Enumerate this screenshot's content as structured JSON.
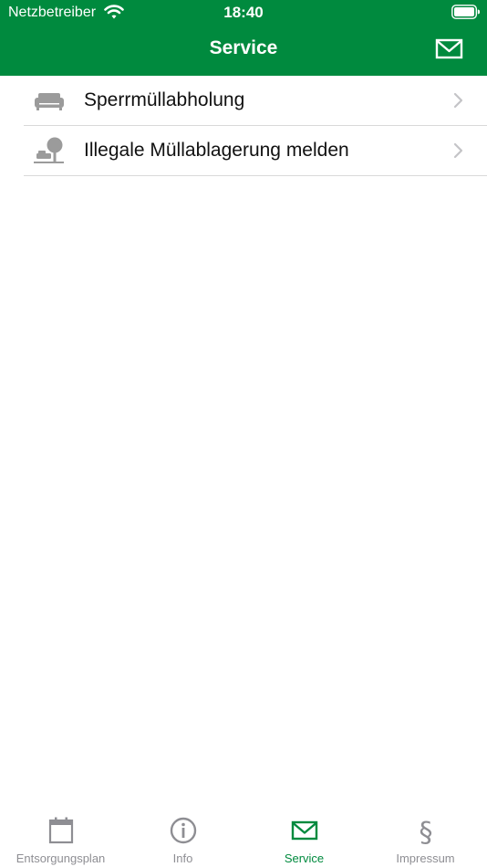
{
  "status_bar": {
    "carrier": "Netzbetreiber",
    "time": "18:40",
    "icons": [
      "wifi-icon",
      "battery-icon"
    ]
  },
  "nav": {
    "title": "Service",
    "right_button_icon": "mail-icon"
  },
  "services": [
    {
      "label": "Sperrmüllabholung",
      "icon": "sofa-icon"
    },
    {
      "label": "Illegale Müllablagerung melden",
      "icon": "illegal-dumping-icon"
    }
  ],
  "tabs": [
    {
      "label": "Entsorgungsplan",
      "icon": "calendar-icon",
      "active": false
    },
    {
      "label": "Info",
      "icon": "info-icon",
      "active": false
    },
    {
      "label": "Service",
      "icon": "mail-icon",
      "active": true
    },
    {
      "label": "Impressum",
      "icon": "paragraph-icon",
      "active": false
    }
  ],
  "colors": {
    "brand_green": "#008a3e",
    "inactive_gray": "#8e8e93",
    "icon_gray": "#9b9b9b",
    "chevron_gray": "#c4c4c7",
    "separator": "#d9d9d9"
  }
}
